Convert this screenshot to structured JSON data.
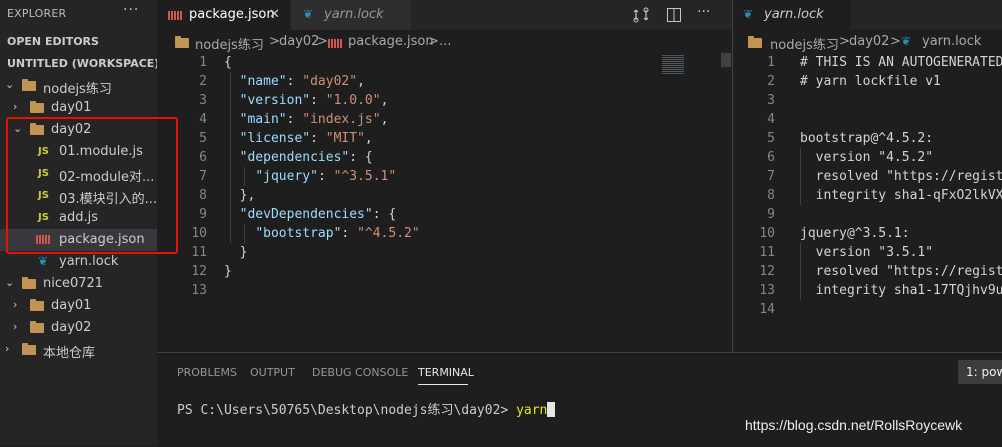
{
  "sidebar": {
    "explorer_title": "EXPLORER",
    "more_label": "···",
    "open_editors": "OPEN EDITORS",
    "workspace": "UNTITLED (WORKSPACE)",
    "tree": [
      {
        "label": "nodejs练习",
        "type": "root"
      },
      {
        "label": "day01",
        "type": "folder"
      },
      {
        "label": "day02",
        "type": "folder-open"
      },
      {
        "label": "01.module.js",
        "type": "js"
      },
      {
        "label": "02-module对...",
        "type": "js"
      },
      {
        "label": "03.模块引入的...",
        "type": "js"
      },
      {
        "label": "add.js",
        "type": "js"
      },
      {
        "label": "package.json",
        "type": "json"
      },
      {
        "label": "yarn.lock",
        "type": "yarn"
      },
      {
        "label": "nice0721",
        "type": "root"
      },
      {
        "label": "day01",
        "type": "folder"
      },
      {
        "label": "day02",
        "type": "folder"
      },
      {
        "label": "本地仓库",
        "type": "root"
      }
    ]
  },
  "editor1": {
    "tabs": [
      {
        "label": "package.json",
        "close": "✕"
      },
      {
        "label": "yarn.lock"
      }
    ],
    "breadcrumb": {
      "root": "nodejs练习",
      "sep": ">",
      "folder": "day02",
      "file": "package.json",
      "more": "..."
    },
    "line_numbers": [
      "1",
      "2",
      "3",
      "4",
      "5",
      "6",
      "7",
      "8",
      "9",
      "10",
      "11",
      "12",
      "13"
    ]
  },
  "editor2": {
    "tab": "yarn.lock",
    "breadcrumb": {
      "root": "nodejs练习",
      "sep": ">",
      "folder": "day02",
      "file": "yarn.lock"
    },
    "line_numbers": [
      "1",
      "2",
      "3",
      "4",
      "5",
      "6",
      "7",
      "8",
      "9",
      "10",
      "11",
      "12",
      "13",
      "14"
    ],
    "lines": [
      "# THIS IS AN AUTOGENERATED",
      "# yarn lockfile v1",
      "",
      "",
      "bootstrap@^4.5.2:",
      "  version \"4.5.2\"",
      "  resolved \"https://regist",
      "  integrity sha1-qFxO2lkVX",
      "",
      "jquery@^3.5.1:",
      "  version \"3.5.1\"",
      "  resolved \"https://regist",
      "  integrity sha1-17TQjhv9u",
      ""
    ]
  },
  "json_code": {
    "name_key": "\"name\"",
    "name_val": "\"day02\"",
    "version_key": "\"version\"",
    "version_val": "\"1.0.0\"",
    "main_key": "\"main\"",
    "main_val": "\"index.js\"",
    "license_key": "\"license\"",
    "license_val": "\"MIT\"",
    "deps_key": "\"dependencies\"",
    "jquery_key": "\"jquery\"",
    "jquery_val": "\"^3.5.1\"",
    "devdeps_key": "\"devDependencies\"",
    "bootstrap_key": "\"bootstrap\"",
    "bootstrap_val": "\"^4.5.2\""
  },
  "panel": {
    "tabs": [
      "PROBLEMS",
      "OUTPUT",
      "DEBUG CONSOLE",
      "TERMINAL"
    ],
    "active_tab": "TERMINAL",
    "terminal_dropdown": "1: pow",
    "prompt": "PS C:\\Users\\50765\\Desktop\\nodejs练习\\day02>",
    "command": "yarn"
  },
  "watermark": "https://blog.csdn.net/RollsRoycewk",
  "colors": {
    "accent_red_box": "#e51400",
    "json_key": "#9cdcfe",
    "json_string": "#ce9178",
    "terminal_command": "#e5e510"
  }
}
